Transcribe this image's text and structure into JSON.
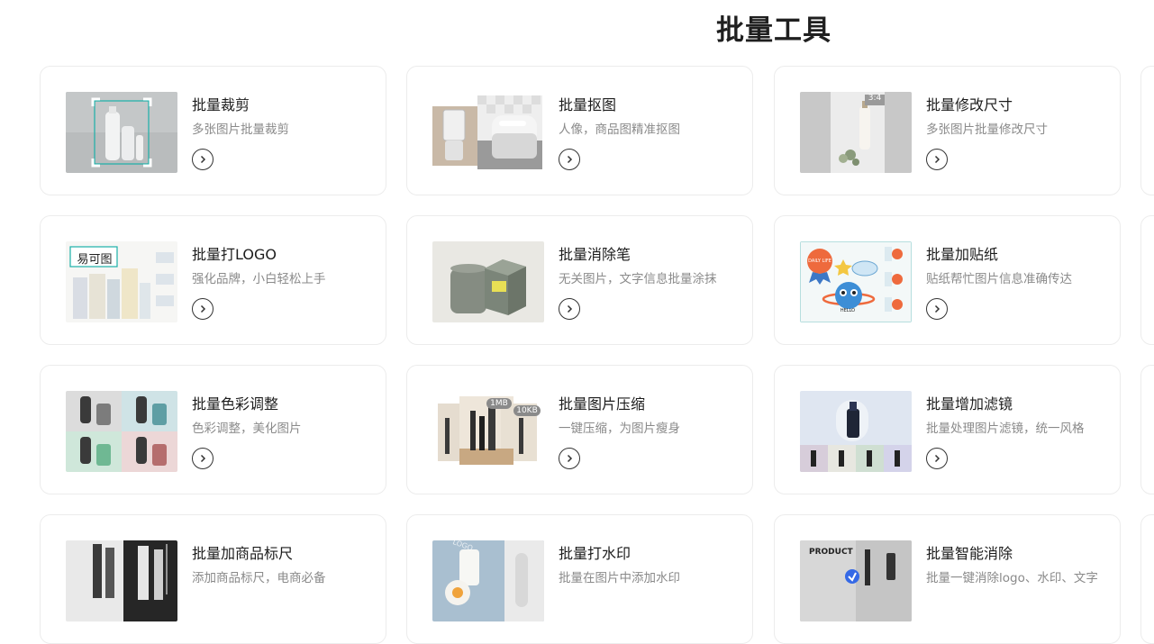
{
  "page": {
    "title": "批量工具"
  },
  "tools": [
    {
      "title": "批量裁剪",
      "desc": "多张图片批量裁剪",
      "thumb_icon": "crop-preview"
    },
    {
      "title": "批量抠图",
      "desc": "人像，商品图精准抠图",
      "thumb_icon": "cutout-preview"
    },
    {
      "title": "批量修改尺寸",
      "desc": "多张图片批量修改尺寸",
      "thumb_icon": "resize-preview",
      "ratio_label": "3:4"
    },
    {
      "title": "批量打LOGO",
      "desc": "强化品牌，小白轻松上手",
      "thumb_icon": "logo-preview",
      "logo_text": "易可图"
    },
    {
      "title": "批量消除笔",
      "desc": "无关图片，文字信息批量涂抹",
      "thumb_icon": "eraser-preview"
    },
    {
      "title": "批量加贴纸",
      "desc": "贴纸帮忙图片信息准确传达",
      "thumb_icon": "sticker-preview",
      "sticker_text": "DAILY LIFE",
      "sticker_text2": "HELLO"
    },
    {
      "title": "批量色彩调整",
      "desc": "色彩调整，美化图片",
      "thumb_icon": "color-adjust-preview"
    },
    {
      "title": "批量图片压缩",
      "desc": "一键压缩，为图片瘦身",
      "thumb_icon": "compress-preview",
      "size_before": "1MB",
      "size_after": "10KB"
    },
    {
      "title": "批量增加滤镜",
      "desc": "批量处理图片滤镜，统一风格",
      "thumb_icon": "filter-preview"
    },
    {
      "title": "批量加商品标尺",
      "desc": "添加商品标尺，电商必备",
      "thumb_icon": "ruler-preview"
    },
    {
      "title": "批量打水印",
      "desc": "批量在图片中添加水印",
      "thumb_icon": "watermark-preview",
      "watermark_text": "LOGO"
    },
    {
      "title": "批量智能消除",
      "desc": "批量一键消除logo、水印、文字",
      "thumb_icon": "smart-erase-preview",
      "product_text": "PRODUCT"
    }
  ],
  "colors": {
    "title": "#1f1f1f",
    "desc": "#8a8a8a",
    "border": "#ececec",
    "crop_accent": "#1bb0a8"
  }
}
